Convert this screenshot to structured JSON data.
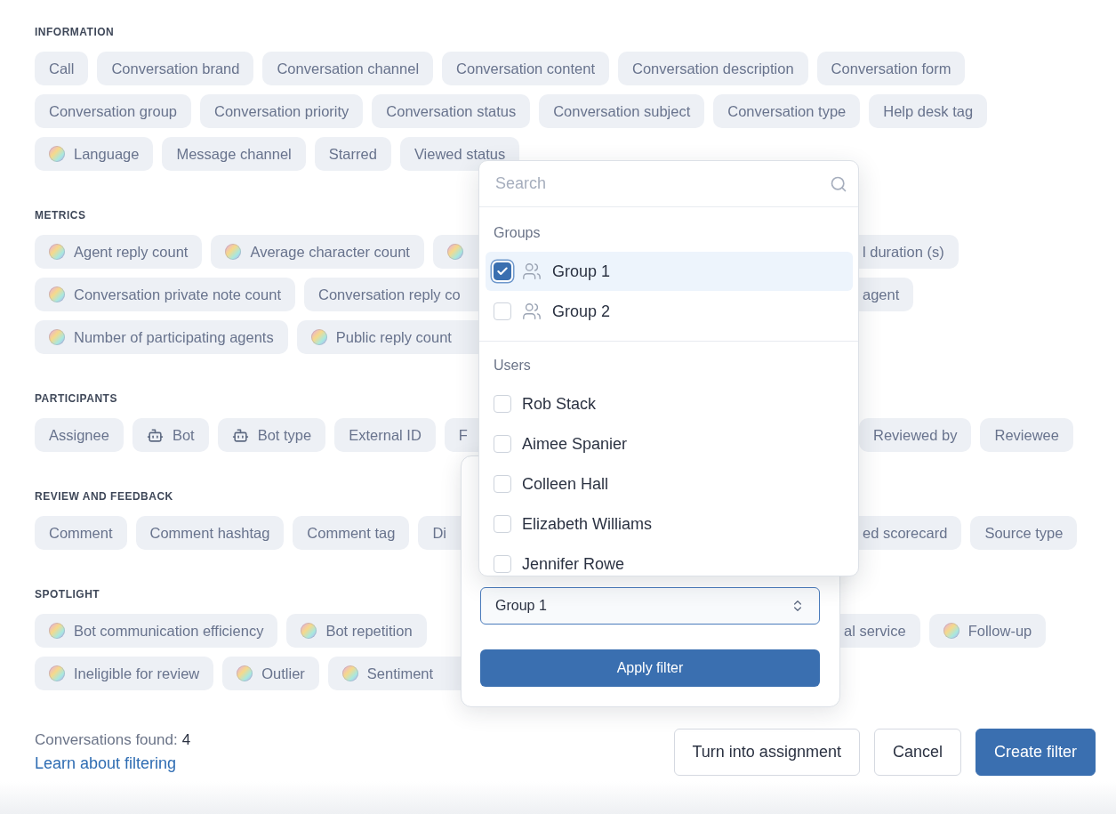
{
  "sections": [
    {
      "title": "INFORMATION",
      "rows": [
        {
          "chips": [
            {
              "label": "Call",
              "kind": "plain"
            },
            {
              "label": "Conversation brand",
              "kind": "plain"
            },
            {
              "label": "Conversation channel",
              "kind": "plain"
            },
            {
              "label": "Conversation content",
              "kind": "plain"
            },
            {
              "label": "Conversation description",
              "kind": "plain"
            },
            {
              "label": "Conversation form",
              "kind": "plain"
            }
          ]
        },
        {
          "chips": [
            {
              "label": "Conversation group",
              "kind": "plain"
            },
            {
              "label": "Conversation priority",
              "kind": "plain"
            },
            {
              "label": "Conversation status",
              "kind": "plain"
            },
            {
              "label": "Conversation subject",
              "kind": "plain"
            },
            {
              "label": "Conversation type",
              "kind": "plain"
            },
            {
              "label": "Help desk tag",
              "kind": "plain"
            }
          ]
        },
        {
          "chips": [
            {
              "label": "Language",
              "kind": "ai"
            },
            {
              "label": "Message channel",
              "kind": "plain"
            },
            {
              "label": "Starred",
              "kind": "plain"
            },
            {
              "label": "Viewed status",
              "kind": "plain"
            }
          ]
        }
      ]
    },
    {
      "title": "METRICS",
      "rows": [
        {
          "chips": [
            {
              "label": "Agent reply count",
              "kind": "ai"
            },
            {
              "label": "Average character count",
              "kind": "ai"
            },
            {
              "kind": "ai_cut_end"
            }
          ],
          "right_chips": [
            {
              "label": "l duration (s)",
              "kind": "plain_cut_start"
            }
          ]
        },
        {
          "chips": [
            {
              "label": "Conversation private note count",
              "kind": "ai"
            },
            {
              "label": "Conversation reply co",
              "kind": "plain_cut_end"
            }
          ],
          "right_chips": [
            {
              "label": "agent",
              "kind": "plain_cut_start"
            }
          ]
        },
        {
          "chips": [
            {
              "label": "Number of participating agents",
              "kind": "ai"
            },
            {
              "label": "Public reply count",
              "kind": "ai_cut_end"
            }
          ]
        }
      ]
    },
    {
      "title": "PARTICIPANTS",
      "rows": [
        {
          "chips": [
            {
              "label": "Assignee",
              "kind": "plain"
            },
            {
              "label": "Bot",
              "kind": "bot"
            },
            {
              "label": "Bot type",
              "kind": "bot"
            },
            {
              "label": "External ID",
              "kind": "plain"
            },
            {
              "label": "F",
              "kind": "plain_cut_end"
            }
          ],
          "right_chips": [
            {
              "label": "Reviewed by",
              "kind": "plain"
            },
            {
              "label": "Reviewee",
              "kind": "plain"
            }
          ]
        }
      ]
    },
    {
      "title": "REVIEW AND FEEDBACK",
      "rows": [
        {
          "chips": [
            {
              "label": "Comment",
              "kind": "plain"
            },
            {
              "label": "Comment hashtag",
              "kind": "plain"
            },
            {
              "label": "Comment tag",
              "kind": "plain"
            },
            {
              "label": "Di",
              "kind": "plain_cut_end"
            }
          ],
          "right_chips": [
            {
              "label": "ed scorecard",
              "kind": "plain_cut_start"
            },
            {
              "label": "Source type",
              "kind": "plain"
            }
          ]
        }
      ]
    },
    {
      "title": "SPOTLIGHT",
      "rows": [
        {
          "chips": [
            {
              "label": "Bot communication efficiency",
              "kind": "ai"
            },
            {
              "label": "Bot repetition",
              "kind": "ai"
            }
          ],
          "right_chips": [
            {
              "label": "al service",
              "kind": "plain_cut_start"
            },
            {
              "label": "Follow-up",
              "kind": "ai"
            }
          ]
        },
        {
          "chips": [
            {
              "label": "Ineligible for review",
              "kind": "ai"
            },
            {
              "label": "Outlier",
              "kind": "ai"
            },
            {
              "label": "Sentiment",
              "kind": "ai_cut_end"
            }
          ]
        }
      ]
    }
  ],
  "filter_popover": {
    "select_value": "Group 1",
    "apply_button": "Apply filter"
  },
  "dropdown": {
    "search": {
      "placeholder": "Search"
    },
    "groups": [
      {
        "title": "Groups",
        "items": [
          {
            "label": "Group 1",
            "checked": true,
            "highlighted": true,
            "kind": "group"
          },
          {
            "label": "Group 2",
            "checked": false,
            "highlighted": false,
            "kind": "group"
          }
        ]
      },
      {
        "title": "Users",
        "items": [
          {
            "label": "Rob Stack",
            "checked": false,
            "highlighted": false,
            "kind": "user"
          },
          {
            "label": "Aimee Spanier",
            "checked": false,
            "highlighted": false,
            "kind": "user"
          },
          {
            "label": "Colleen Hall",
            "checked": false,
            "highlighted": false,
            "kind": "user"
          },
          {
            "label": "Elizabeth Williams",
            "checked": false,
            "highlighted": false,
            "kind": "user"
          },
          {
            "label": "Jennifer Rowe",
            "checked": false,
            "highlighted": false,
            "kind": "user"
          }
        ]
      }
    ]
  },
  "footer": {
    "found_label": "Conversations found:",
    "found_count": "4",
    "link": "Learn about filtering",
    "buttons": [
      {
        "label": "Turn into assignment",
        "kind": "secondary"
      },
      {
        "label": "Cancel",
        "kind": "secondary"
      },
      {
        "label": "Create filter",
        "kind": "primary"
      }
    ]
  }
}
